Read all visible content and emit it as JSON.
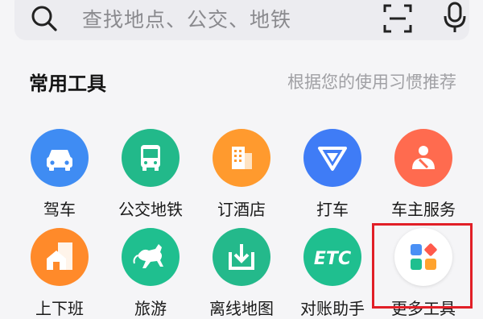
{
  "search": {
    "placeholder": "查找地点、公交、地铁",
    "icons": [
      "search-icon",
      "scan-icon",
      "microphone-icon"
    ]
  },
  "section": {
    "title": "常用工具",
    "hint": "根据您的使用习惯推荐"
  },
  "tools": [
    {
      "label": "驾车",
      "icon": "car-icon",
      "color": "#3f8cf3"
    },
    {
      "label": "公交地铁",
      "icon": "bus-icon",
      "color": "#22b98a"
    },
    {
      "label": "订酒店",
      "icon": "hotel-icon",
      "color": "#ff9a2e"
    },
    {
      "label": "打车",
      "icon": "taxi-icon",
      "color": "#3f7cf6"
    },
    {
      "label": "车主服务",
      "icon": "car-owner-service-icon",
      "color": "#ff6b4f"
    },
    {
      "label": "上下班",
      "icon": "commute-icon",
      "color": "#ff8a2a"
    },
    {
      "label": "旅游",
      "icon": "travel-horse-icon",
      "color": "#1fbf8f"
    },
    {
      "label": "离线地图",
      "icon": "offline-map-download-icon",
      "color": "#24b98b"
    },
    {
      "label": "对账助手",
      "icon": "etc-icon",
      "color": "#1fbf8f"
    },
    {
      "label": "更多工具",
      "icon": "more-tools-grid-icon",
      "color": "#ffffff"
    }
  ],
  "highlight_color": "#e11f27"
}
